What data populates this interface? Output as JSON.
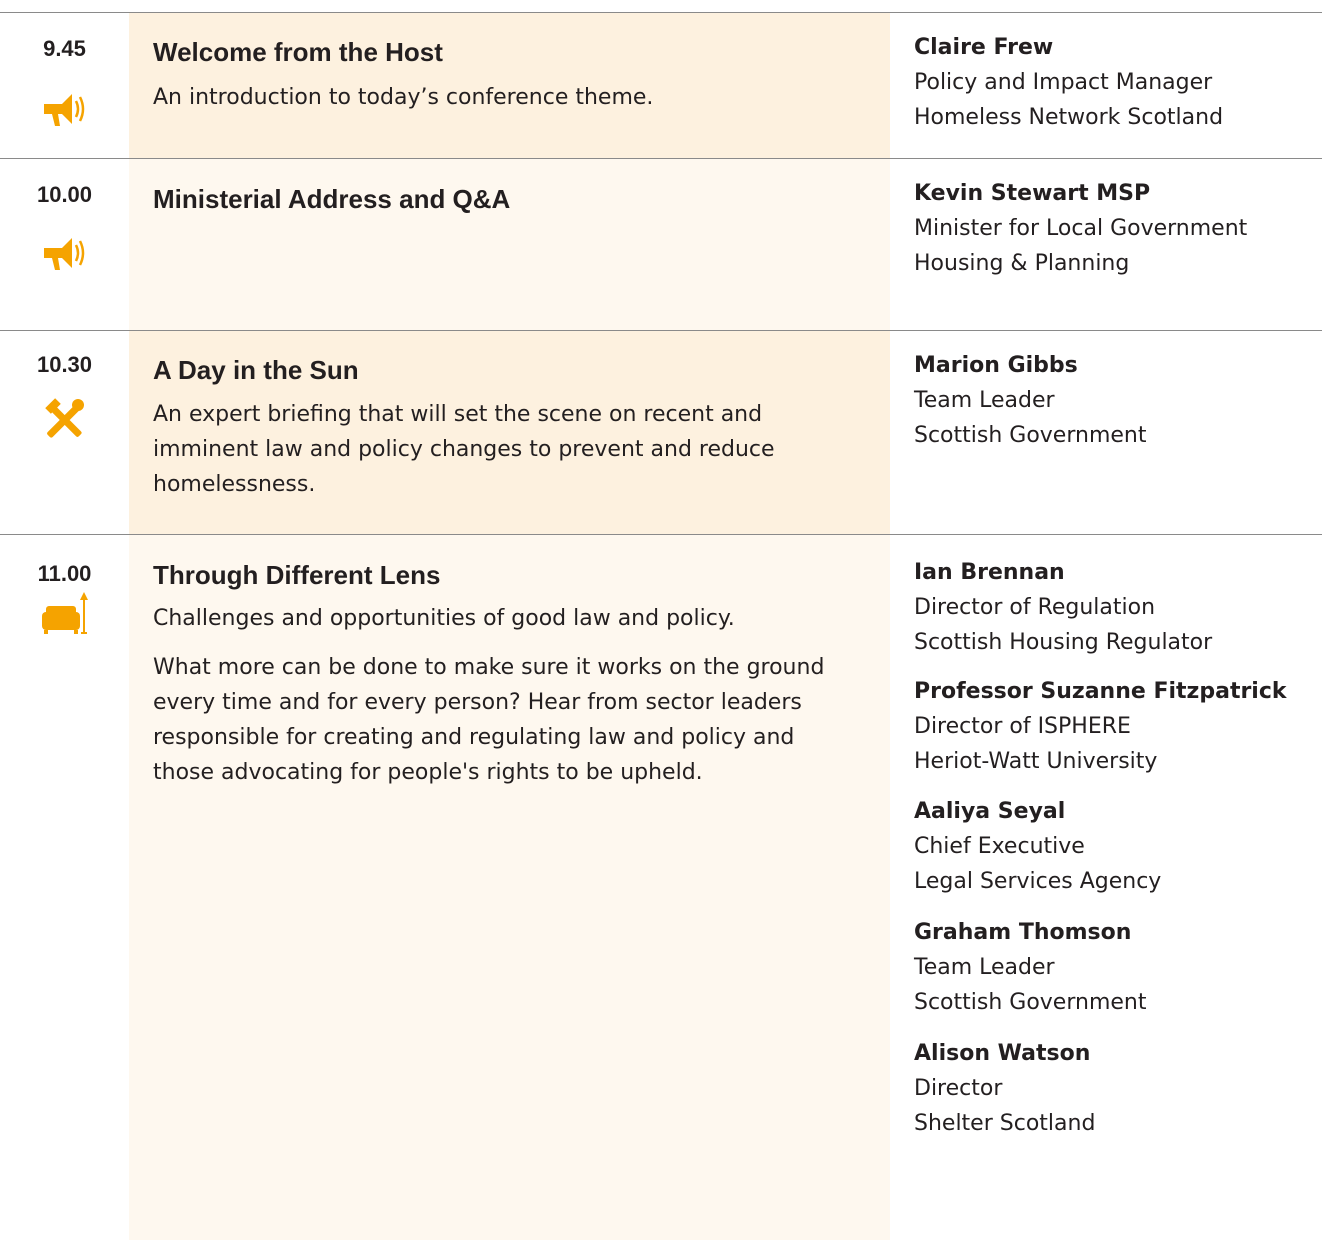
{
  "colors": {
    "accent": "#f5a300",
    "row_shade": "#fdf1df",
    "row_shade_light": "#fef8ef",
    "divider": "#8a8a8a"
  },
  "sessions": [
    {
      "time": "9.45",
      "icon": "megaphone-icon",
      "title": "Welcome from the Host",
      "description": [
        "An introduction to today’s conference theme."
      ],
      "speakers": [
        {
          "name": "Claire Frew",
          "role": "Policy and Impact Manager",
          "org": "Homeless Network Scotland"
        }
      ]
    },
    {
      "time": "10.00",
      "icon": "megaphone-icon",
      "title": "Ministerial Address and Q&A",
      "description": [],
      "speakers": [
        {
          "name": "Kevin Stewart MSP",
          "role": "Minister for Local Government",
          "org": "Housing & Planning"
        }
      ]
    },
    {
      "time": "10.30",
      "icon": "tools-icon",
      "title": "A Day in the Sun",
      "description": [
        "An expert briefing that will set the scene on recent and imminent law and policy changes to prevent and reduce homelessness."
      ],
      "speakers": [
        {
          "name": "Marion Gibbs",
          "role": "Team Leader",
          "org": "Scottish Government"
        }
      ]
    },
    {
      "time": "11.00",
      "icon": "sofa-lamp-icon",
      "title": "Through Different Lens",
      "description": [
        "Challenges and opportunities of good law and policy.",
        "What more can be done to make sure it works on the ground every time and for every person? Hear from sector leaders responsible for creating and regulating law and policy and those advocating for people's rights to be upheld."
      ],
      "speakers": [
        {
          "name": "Ian Brennan",
          "role": "Director of Regulation",
          "org": "Scottish Housing Regulator"
        },
        {
          "name": "Professor Suzanne Fitzpatrick",
          "role": "Director of ISPHERE",
          "org": "Heriot-Watt University"
        },
        {
          "name": "Aaliya Seyal",
          "role": "Chief Executive",
          "org": "Legal Services Agency"
        },
        {
          "name": "Graham Thomson",
          "role": "Team Leader",
          "org": "Scottish Government"
        },
        {
          "name": "Alison Watson",
          "role": "Director",
          "org": "Shelter Scotland"
        }
      ]
    }
  ]
}
